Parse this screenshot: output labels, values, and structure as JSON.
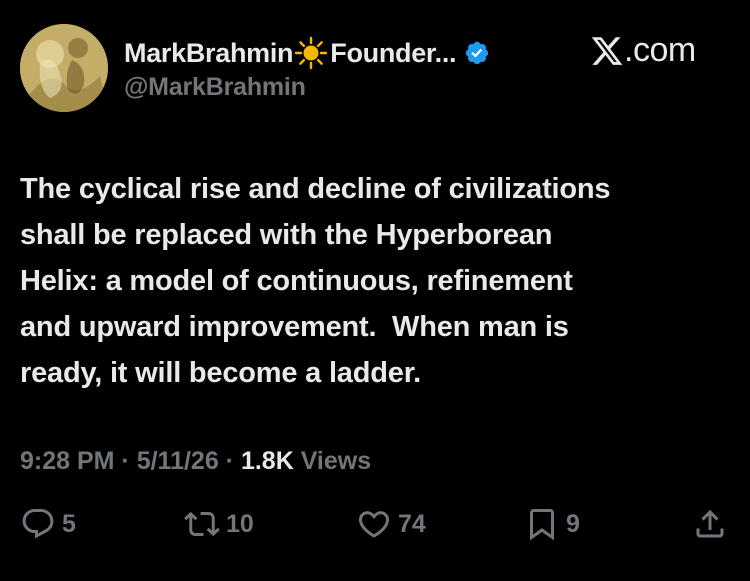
{
  "author": {
    "display_name": "MarkBrahmin",
    "title_suffix": "Founder...",
    "handle": "@MarkBrahmin",
    "avatar_icon": "avatar-icon",
    "name_emoji_icon": "sun-icon",
    "verified_icon": "verified-badge-icon",
    "verified_color": "#1d9bf0"
  },
  "brand": {
    "logo_icon": "x-logo-icon",
    "domain": ".com"
  },
  "tweet": {
    "lines": [
      "The cyclical rise and decline of civilizations",
      "shall be replaced with the Hyperborean",
      "Helix: a model of continuous, refinement",
      "and upward improvement.  When man is",
      "ready, it will become a ladder."
    ]
  },
  "meta": {
    "time": "9:28 PM",
    "separator": " · ",
    "date": "5/11/26",
    "views_count": "1.8K",
    "views_label": " Views"
  },
  "actions": {
    "reply": {
      "icon": "reply-icon",
      "count": "5"
    },
    "repost": {
      "icon": "repost-icon",
      "count": "10"
    },
    "like": {
      "icon": "heart-icon",
      "count": "74"
    },
    "bookmark": {
      "icon": "bookmark-icon",
      "count": "9"
    },
    "share": {
      "icon": "share-icon"
    }
  },
  "colors": {
    "background": "#000000",
    "text": "#e7e9ea",
    "muted": "#71767b",
    "verified": "#1d9bf0",
    "sun": "#f5b800"
  }
}
